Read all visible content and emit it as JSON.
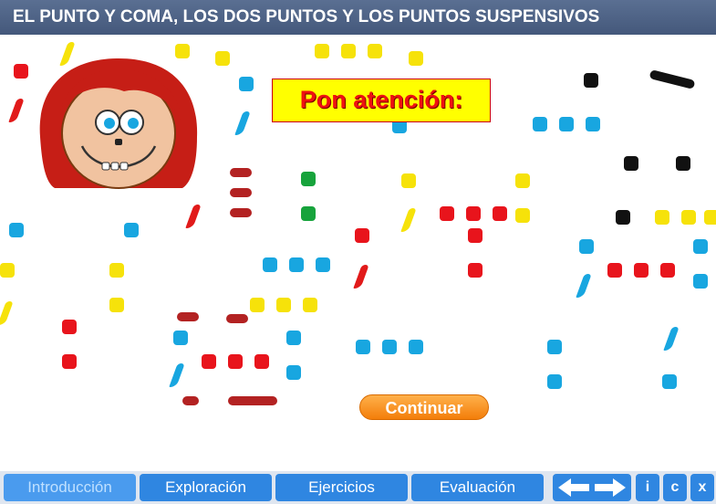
{
  "header": {
    "title": "EL PUNTO Y COMA, LOS DOS PUNTOS Y LOS PUNTOS SUSPENSIVOS"
  },
  "callout": {
    "text": "Pon atención:"
  },
  "continue_button": {
    "label": "Continuar"
  },
  "nav": {
    "tabs": [
      {
        "label": "Introducción",
        "active": true
      },
      {
        "label": "Exploración",
        "active": false
      },
      {
        "label": "Ejercicios",
        "active": false
      },
      {
        "label": "Evaluación",
        "active": false
      }
    ],
    "info_label": "i",
    "credits_label": "c",
    "close_label": "x"
  },
  "colors": {
    "header_bg": "#4d6185",
    "nav_bg": "#2f86e1",
    "callout_bg": "#ffff00",
    "callout_text": "#ee1111",
    "button_orange": "#f58a14"
  }
}
